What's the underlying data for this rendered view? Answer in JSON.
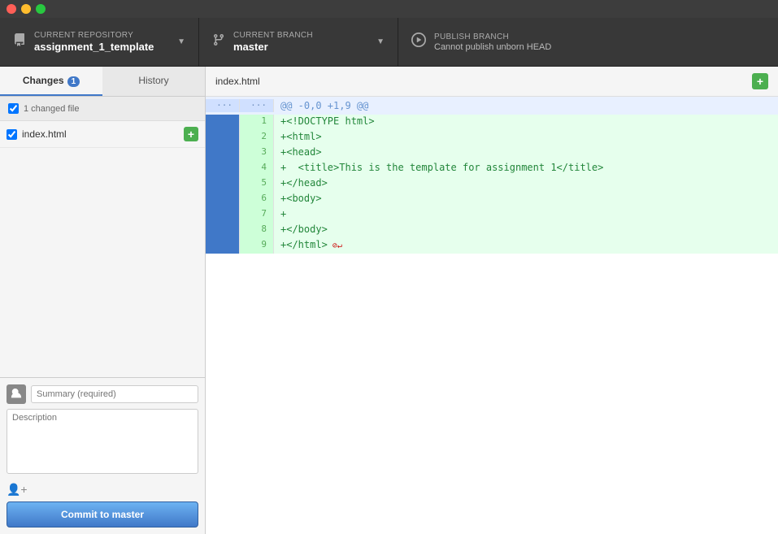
{
  "titlebar": {
    "controls": [
      "close",
      "minimize",
      "maximize"
    ]
  },
  "toolbar": {
    "repo_label": "Current Repository",
    "repo_name": "assignment_1_template",
    "branch_label": "Current Branch",
    "branch_name": "master",
    "publish_label": "Publish branch",
    "publish_subtitle": "Cannot publish unborn HEAD"
  },
  "tabs": [
    {
      "id": "changes",
      "label": "Changes",
      "badge": "1",
      "active": true
    },
    {
      "id": "history",
      "label": "History",
      "badge": "",
      "active": false
    }
  ],
  "changed_files": {
    "header": "1 changed file",
    "files": [
      {
        "name": "index.html",
        "checked": true
      }
    ]
  },
  "diff": {
    "filename": "index.html",
    "hunk_header": "@@ -0,0 +1,9 @@",
    "lines": [
      {
        "num": "1",
        "content": "+<!DOCTYPE html>",
        "type": "added"
      },
      {
        "num": "2",
        "content": "+<html>",
        "type": "added"
      },
      {
        "num": "3",
        "content": "+<head>",
        "type": "added"
      },
      {
        "num": "4",
        "content": "+  <title>This is the template for assignment 1</title>",
        "type": "added"
      },
      {
        "num": "5",
        "content": "+</head>",
        "type": "added"
      },
      {
        "num": "6",
        "content": "+<body>",
        "type": "added"
      },
      {
        "num": "7",
        "content": "+",
        "type": "added"
      },
      {
        "num": "8",
        "content": "+</body>",
        "type": "added"
      },
      {
        "num": "9",
        "content": "+</html>",
        "type": "added",
        "no_newline": true
      }
    ]
  },
  "commit": {
    "summary_placeholder": "Summary (required)",
    "description_placeholder": "Description",
    "button_label": "Commit to master"
  }
}
